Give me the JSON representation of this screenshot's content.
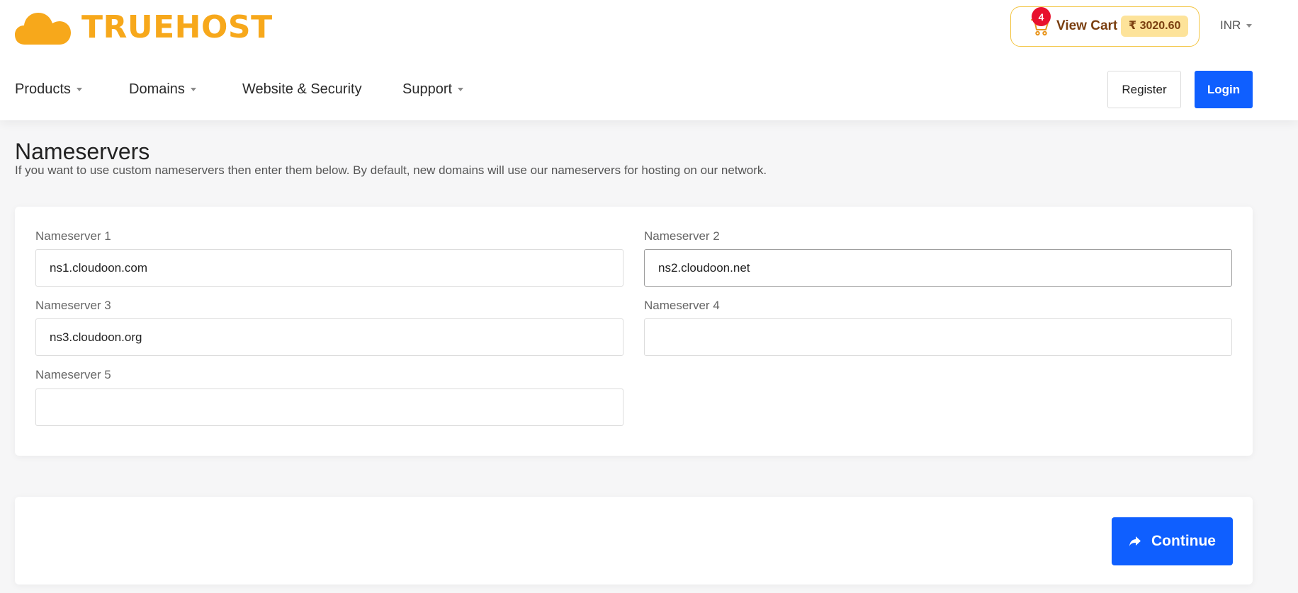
{
  "brand": {
    "name": "TRUEHOST",
    "color": "#f7a81b"
  },
  "cart": {
    "count": "4",
    "label": "View Cart",
    "total": "₹ 3020.60"
  },
  "currency": {
    "selected": "INR"
  },
  "nav": {
    "items": [
      {
        "label": "Products",
        "has_dropdown": true
      },
      {
        "label": "Domains",
        "has_dropdown": true
      },
      {
        "label": "Website & Security",
        "has_dropdown": false
      },
      {
        "label": "Support",
        "has_dropdown": true
      }
    ],
    "register_label": "Register",
    "login_label": "Login"
  },
  "page": {
    "title": "Nameservers",
    "description": "If you want to use custom nameservers then enter them below. By default, new domains will use our nameservers for hosting on our network."
  },
  "nameservers": [
    {
      "label": "Nameserver 1",
      "value": "ns1.cloudoon.com"
    },
    {
      "label": "Nameserver 2",
      "value": "ns2.cloudoon.net"
    },
    {
      "label": "Nameserver 3",
      "value": "ns3.cloudoon.org"
    },
    {
      "label": "Nameserver 4",
      "value": ""
    },
    {
      "label": "Nameserver 5",
      "value": ""
    }
  ],
  "actions": {
    "continue_label": "Continue"
  },
  "colors": {
    "primary": "#0f5fff",
    "badge": "#e8112d",
    "cart_border": "#f3c545",
    "cart_total_bg": "#fde39a"
  }
}
